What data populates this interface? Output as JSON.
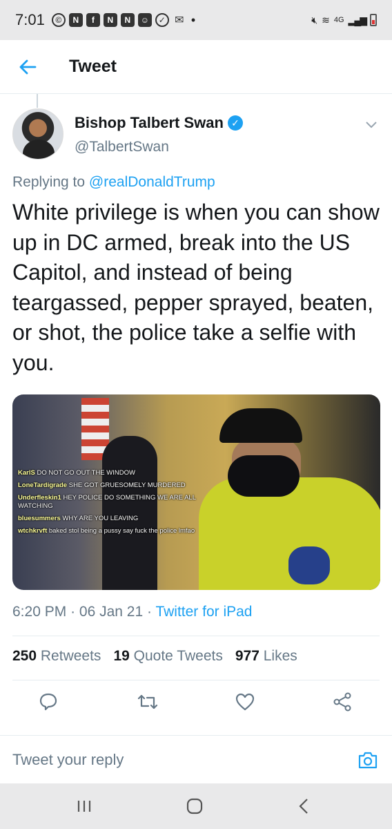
{
  "status_bar": {
    "time": "7:01",
    "network": "4G",
    "icons": [
      "wifi-calling-icon",
      "app-icon",
      "facebook-icon",
      "app-icon",
      "app-icon",
      "app-icon",
      "check-icon",
      "mail-icon"
    ]
  },
  "header": {
    "title": "Tweet"
  },
  "tweet": {
    "author_name": "Bishop Talbert Swan",
    "author_handle": "@TalbertSwan",
    "replying_prefix": "Replying to",
    "replying_to": "@realDonaldTrump",
    "text": "White privilege is when you can show up in DC armed, break into the US Capitol, and instead of being teargassed, pepper sprayed, beaten, or shot, the police take a selfie with you.",
    "time": "6:20 PM",
    "date": "06 Jan 21",
    "source": "Twitter for iPad"
  },
  "media": {
    "chat": [
      {
        "user": "KarlS",
        "text": "DO NOT GO OUT THE WINDOW"
      },
      {
        "user": "LoneTardigrade",
        "text": "SHE GOT GRUESOMELY MURDERED"
      },
      {
        "user": "Underfleskin1",
        "text": "HEY POLICE DO SOMETHING WE ARE ALL WATCHING"
      },
      {
        "user": "bluesummers",
        "text": "WHY ARE YOU LEAVING"
      },
      {
        "user": "wtchkrvft",
        "text": "baked stol being a pussy say fuck the police lmfao"
      }
    ]
  },
  "stats": {
    "retweets_count": "250",
    "retweets_label": "Retweets",
    "quotes_count": "19",
    "quotes_label": "Quote Tweets",
    "likes_count": "977",
    "likes_label": "Likes"
  },
  "reply": {
    "placeholder": "Tweet your reply"
  },
  "colors": {
    "accent": "#1da1f2",
    "secondary_text": "#657786",
    "primary_text": "#14171a"
  }
}
